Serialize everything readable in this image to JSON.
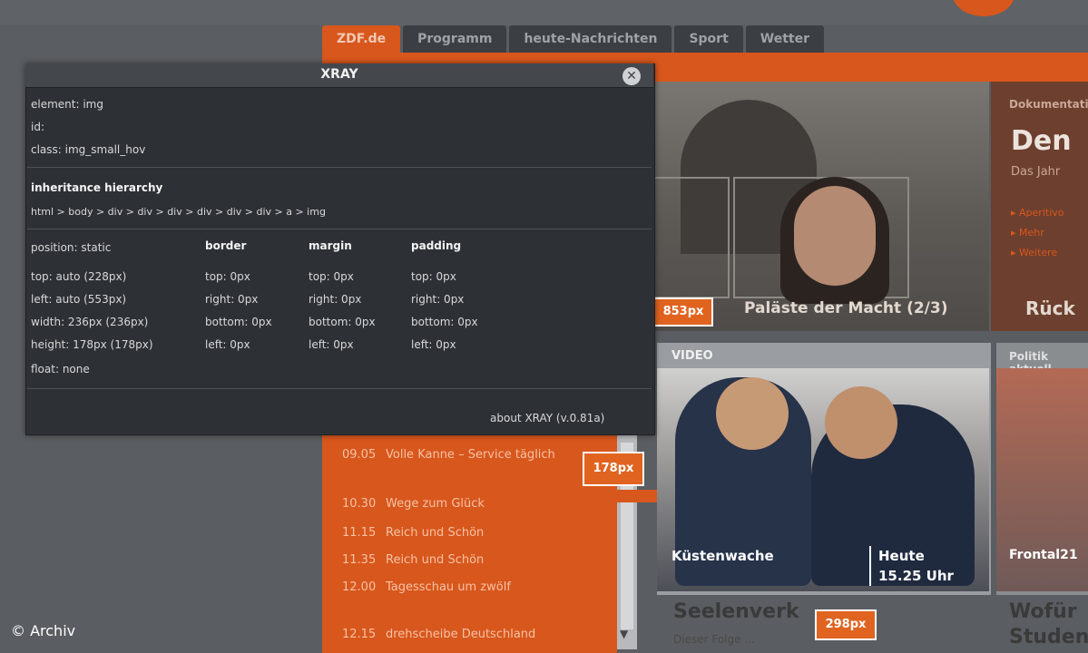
{
  "nav": {
    "tabs": [
      {
        "label": "ZDF.de",
        "active": true
      },
      {
        "label": "Programm",
        "active": false
      },
      {
        "label": "heute-Nachrichten",
        "active": false
      },
      {
        "label": "Sport",
        "active": false
      },
      {
        "label": "Wetter",
        "active": false
      }
    ]
  },
  "hero": {
    "caption": "Paläste der Macht (2/3)",
    "badge": "853px"
  },
  "right_panel": {
    "title": "Dokumentation",
    "big": "Den",
    "sub": "Das Jahr",
    "links": [
      "Aperitivo",
      "Mehr",
      "Weitere"
    ],
    "bottom": "Rück"
  },
  "video": {
    "label": "VIDEO",
    "caption": "Küstenwache",
    "heute": "Heute",
    "time": "15.25 Uhr",
    "title": "Seelenverk",
    "subtitle": "Dieser Folge ...",
    "badge": "298px"
  },
  "right_lower": {
    "label": "Politik aktuell",
    "caption": "Frontal21",
    "title1": "Wofür",
    "title2": "Studen"
  },
  "schedule": {
    "badge": "178px",
    "rows": [
      {
        "time": "09.05",
        "title": "Volle Kanne – Service täglich"
      },
      {
        "time": "10.30",
        "title": "Wege zum Glück"
      },
      {
        "time": "11.15",
        "title": "Reich und Schön"
      },
      {
        "time": "11.35",
        "title": "Reich und Schön"
      },
      {
        "time": "12.00",
        "title": "Tagesschau um zwölf"
      },
      {
        "time": "12.15",
        "title": "drehscheibe Deutschland"
      }
    ]
  },
  "xray": {
    "title": "XRAY",
    "close_icon": "close-icon",
    "element": "element: img",
    "id": "id:",
    "class": "class: img_small_hov",
    "hierarchy_label": "inheritance hierarchy",
    "hierarchy": "html > body > div > div > div > div > div > div > a > img",
    "position": "position: static",
    "top": "top: auto (228px)",
    "left": "left: auto (553px)",
    "width": "width: 236px (236px)",
    "height": "height: 178px (178px)",
    "float": "float: none",
    "border": {
      "head": "border",
      "top": "top: 0px",
      "right": "right: 0px",
      "bottom": "bottom: 0px",
      "left": "left: 0px"
    },
    "margin": {
      "head": "margin",
      "top": "top: 0px",
      "right": "right: 0px",
      "bottom": "bottom: 0px",
      "left": "left: 0px"
    },
    "padding": {
      "head": "padding",
      "top": "top: 0px",
      "right": "right: 0px",
      "bottom": "bottom: 0px",
      "left": "left: 0px"
    },
    "footer": "about XRAY (v.0.81a)"
  },
  "copyright": "© Archiv",
  "colors": {
    "accent": "#d8571c",
    "panel": "#2d3136",
    "page": "#5a5d61"
  }
}
